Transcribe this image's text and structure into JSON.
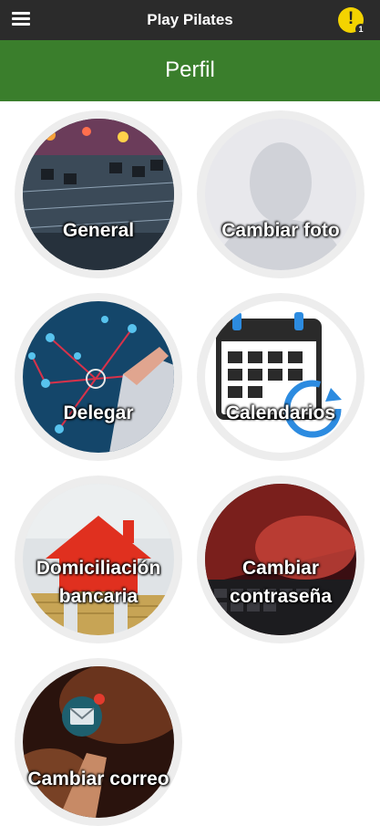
{
  "app": {
    "title": "Play Pilates",
    "alert_count": "1"
  },
  "header": {
    "title": "Perfil"
  },
  "tiles": [
    {
      "label": "General"
    },
    {
      "label": "Cambiar foto"
    },
    {
      "label": "Delegar"
    },
    {
      "label": "Calendarios"
    },
    {
      "label_line1": "Domiciliación",
      "label_line2": "bancaria"
    },
    {
      "label_line1": "Cambiar",
      "label_line2": "contraseña"
    },
    {
      "label": "Cambiar correo"
    }
  ],
  "colors": {
    "topbar": "#2b2b2b",
    "header": "#3a7e2c",
    "alert": "#f3d300"
  }
}
